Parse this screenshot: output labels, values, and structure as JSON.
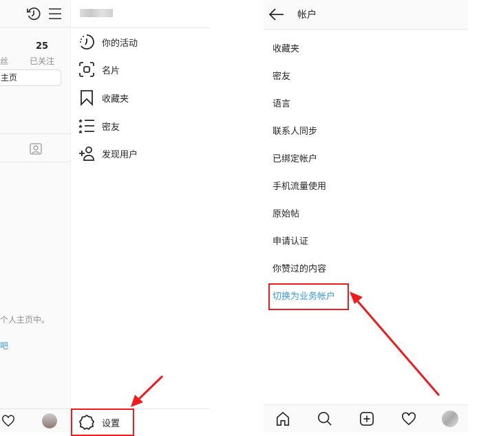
{
  "left_screen": {
    "profile": {
      "following_count": "25",
      "followers_label_partial": "丝",
      "following_label": "已关注",
      "edit_profile_partial": "主页",
      "empty_text_partial": "个人主页中。",
      "link_partial": "吧"
    },
    "menu": {
      "username": "",
      "items": [
        {
          "label": "你的活动",
          "icon": "activity-icon"
        },
        {
          "label": "名片",
          "icon": "nametag-icon"
        },
        {
          "label": "收藏夹",
          "icon": "bookmark-icon"
        },
        {
          "label": "密友",
          "icon": "close-friends-icon"
        },
        {
          "label": "发现用户",
          "icon": "add-user-icon"
        }
      ],
      "settings_label": "设置"
    }
  },
  "right_screen": {
    "title": "帐户",
    "items": [
      "收藏夹",
      "密友",
      "语言",
      "联系人同步",
      "已绑定帐户",
      "手机流量使用",
      "原始帖",
      "申请认证",
      "你赞过的内容"
    ],
    "highlight_item": "切换为业务帐户"
  },
  "colors": {
    "annotation": "#f21b1b",
    "link": "#3897f0"
  }
}
